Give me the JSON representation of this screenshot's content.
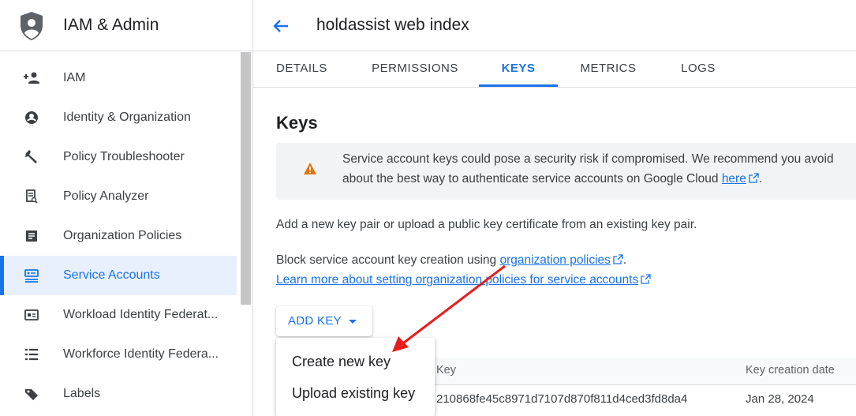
{
  "sidebar": {
    "title": "IAM & Admin",
    "items": [
      {
        "label": "IAM",
        "icon": "add-person-icon"
      },
      {
        "label": "Identity & Organization",
        "icon": "account-circle-icon"
      },
      {
        "label": "Policy Troubleshooter",
        "icon": "wrench-icon"
      },
      {
        "label": "Policy Analyzer",
        "icon": "document-search-icon"
      },
      {
        "label": "Organization Policies",
        "icon": "article-icon"
      },
      {
        "label": "Service Accounts",
        "icon": "service-account-icon",
        "active": true
      },
      {
        "label": "Workload Identity Federat...",
        "icon": "id-card-icon"
      },
      {
        "label": "Workforce Identity Federa...",
        "icon": "list-icon"
      },
      {
        "label": "Labels",
        "icon": "label-icon"
      }
    ]
  },
  "header": {
    "title": "holdassist web index"
  },
  "tabs": [
    {
      "label": "DETAILS"
    },
    {
      "label": "PERMISSIONS"
    },
    {
      "label": "KEYS",
      "active": true
    },
    {
      "label": "METRICS"
    },
    {
      "label": "LOGS"
    }
  ],
  "keys": {
    "heading": "Keys",
    "warning_line1": "Service account keys could pose a security risk if compromised. We recommend you avoid",
    "warning_line2": "about the best way to authenticate service accounts on Google Cloud",
    "warning_link": "here",
    "description": "Add a new key pair or upload a public key certificate from an existing key pair.",
    "block_text": "Block service account key creation using",
    "block_link": "organization policies",
    "learn_more": "Learn more about setting organization policies for service accounts",
    "add_key_label": "ADD KEY",
    "menu": [
      "Create new key",
      "Upload existing key"
    ],
    "table": {
      "headers": {
        "key": "Key",
        "created": "Key creation date"
      },
      "rows": [
        {
          "key": "210868fe45c8971d7107d870f811d4ced3fd8da4",
          "created": "Jan 28, 2024"
        }
      ]
    }
  },
  "colors": {
    "accent": "#1a73e8",
    "warning": "#e8710a",
    "annotation_arrow": "#e81c1c"
  }
}
